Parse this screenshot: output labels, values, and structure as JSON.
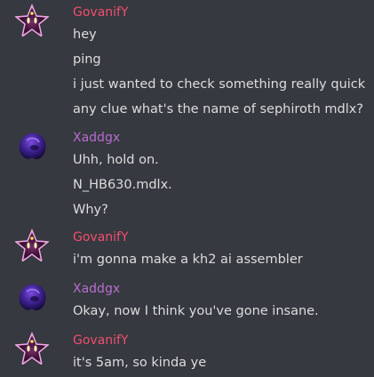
{
  "messages": [
    {
      "author": "GovanifY",
      "avatar": "star-avatar",
      "color": "#f04e6f",
      "lines": [
        "hey",
        "ping",
        "i just wanted to check something really quick",
        "any clue what's the name of sephiroth mdlx?"
      ]
    },
    {
      "author": "Xaddgx",
      "avatar": "purple-blob-avatar",
      "color": "#b76ed0",
      "lines": [
        "Uhh, hold on.",
        "N_HB630.mdlx.",
        "Why?"
      ]
    },
    {
      "author": "GovanifY",
      "avatar": "star-avatar",
      "color": "#f04e6f",
      "lines": [
        "i'm gonna make a kh2 ai assembler"
      ]
    },
    {
      "author": "Xaddgx",
      "avatar": "purple-blob-avatar",
      "color": "#b76ed0",
      "lines": [
        "Okay, now I think you've gone insane."
      ]
    },
    {
      "author": "GovanifY",
      "avatar": "star-avatar",
      "color": "#f04e6f",
      "lines": [
        "it's 5am, so kinda ye"
      ]
    }
  ]
}
